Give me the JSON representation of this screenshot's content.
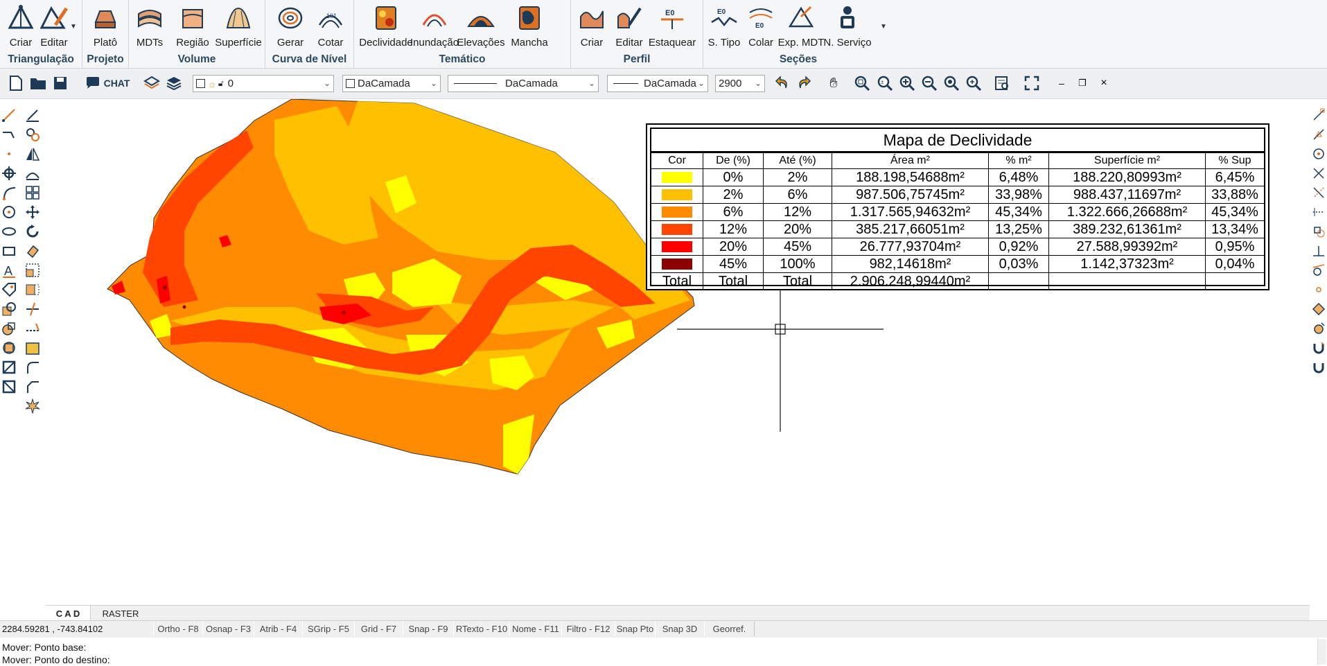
{
  "ribbon": {
    "groups": [
      {
        "title": "Triangulação",
        "buttons": [
          {
            "label": "Criar",
            "icon": "triangulation-create-icon"
          },
          {
            "label": "Editar",
            "icon": "triangulation-edit-icon"
          }
        ]
      },
      {
        "title": "Projeto",
        "buttons": [
          {
            "label": "Platô",
            "icon": "plateau-icon"
          }
        ]
      },
      {
        "title": "Volume",
        "buttons": [
          {
            "label": "MDTs",
            "icon": "mdt-icon"
          },
          {
            "label": "Região",
            "icon": "region-icon"
          },
          {
            "label": "Superfície",
            "icon": "surface-icon"
          }
        ]
      },
      {
        "title": "Curva de Nível",
        "buttons": [
          {
            "label": "Gerar",
            "icon": "contour-generate-icon"
          },
          {
            "label": "Cotar",
            "icon": "contour-label-icon"
          }
        ]
      },
      {
        "title": "Temático",
        "buttons": [
          {
            "label": "Declividade",
            "icon": "slope-icon"
          },
          {
            "label": "Inundação",
            "icon": "flood-icon"
          },
          {
            "label": "Elevações",
            "icon": "elevation-icon"
          },
          {
            "label": "Mancha",
            "icon": "stain-icon"
          }
        ]
      },
      {
        "title": "Perfil",
        "buttons": [
          {
            "label": "Criar",
            "icon": "profile-create-icon"
          },
          {
            "label": "Editar",
            "icon": "profile-edit-icon"
          },
          {
            "label": "Estaquear",
            "icon": "stake-icon"
          }
        ]
      },
      {
        "title": "Seções",
        "buttons": [
          {
            "label": "S. Tipo",
            "icon": "section-type-icon"
          },
          {
            "label": "Colar",
            "icon": "paste-section-icon"
          },
          {
            "label": "Exp. MDT",
            "icon": "export-mdt-icon"
          },
          {
            "label": "N. Serviço",
            "icon": "service-note-icon"
          }
        ]
      }
    ]
  },
  "toolbar": {
    "chat_label": "CHAT",
    "layer_value": "0",
    "color_value": "DaCamada",
    "linetype_value": "DaCamada",
    "lineweight_value": "DaCamada",
    "scale_value": "2900",
    "window_minimize": "–",
    "window_restore": "❐",
    "window_close": "×"
  },
  "slope_table": {
    "title": "Mapa de Declividade",
    "headers": [
      "Cor",
      "De (%)",
      "Até (%)",
      "Área m²",
      "% m²",
      "Superfície m²",
      "% Sup"
    ],
    "rows": [
      {
        "color": "#ffff00",
        "from": "0%",
        "to": "2%",
        "area": "188.198,54688m²",
        "pct_area": "6,48%",
        "surface": "188.220,80993m²",
        "pct_surface": "6,45%"
      },
      {
        "color": "#ffc000",
        "from": "2%",
        "to": "6%",
        "area": "987.506,75745m²",
        "pct_area": "33,98%",
        "surface": "988.437,11697m²",
        "pct_surface": "33,88%"
      },
      {
        "color": "#ff8c00",
        "from": "6%",
        "to": "12%",
        "area": "1.317.565,94632m²",
        "pct_area": "45,34%",
        "surface": "1.322.666,26688m²",
        "pct_surface": "45,34%"
      },
      {
        "color": "#ff4500",
        "from": "12%",
        "to": "20%",
        "area": "385.217,66051m²",
        "pct_area": "13,25%",
        "surface": "389.232,61361m²",
        "pct_surface": "13,34%"
      },
      {
        "color": "#ff0000",
        "from": "20%",
        "to": "45%",
        "area": "26.777,93704m²",
        "pct_area": "0,92%",
        "surface": "27.588,99392m²",
        "pct_surface": "0,95%"
      },
      {
        "color": "#8b0000",
        "from": "45%",
        "to": "100%",
        "area": "982,14618m²",
        "pct_area": "0,03%",
        "surface": "1.142,37323m²",
        "pct_surface": "0,04%"
      }
    ],
    "total": {
      "c1": "Total",
      "c2": "Total",
      "c3": "Total",
      "area": "2.906.248,99440m²"
    }
  },
  "tabs": [
    "C A D",
    "RASTER"
  ],
  "status": {
    "coordinates": "2284.59281 , -743.84102",
    "buttons": [
      "Ortho - F8",
      "Osnap - F3",
      "Atrib - F4",
      "SGrip - F5",
      "Grid - F7",
      "Snap - F9",
      "RTexto - F10",
      "Nome - F11",
      "Filtro - F12",
      "Snap Pto",
      "Snap 3D",
      "Georref."
    ]
  },
  "command": {
    "line1": "Mover: Ponto base:",
    "line2": "Mover: Ponto do destino:"
  }
}
